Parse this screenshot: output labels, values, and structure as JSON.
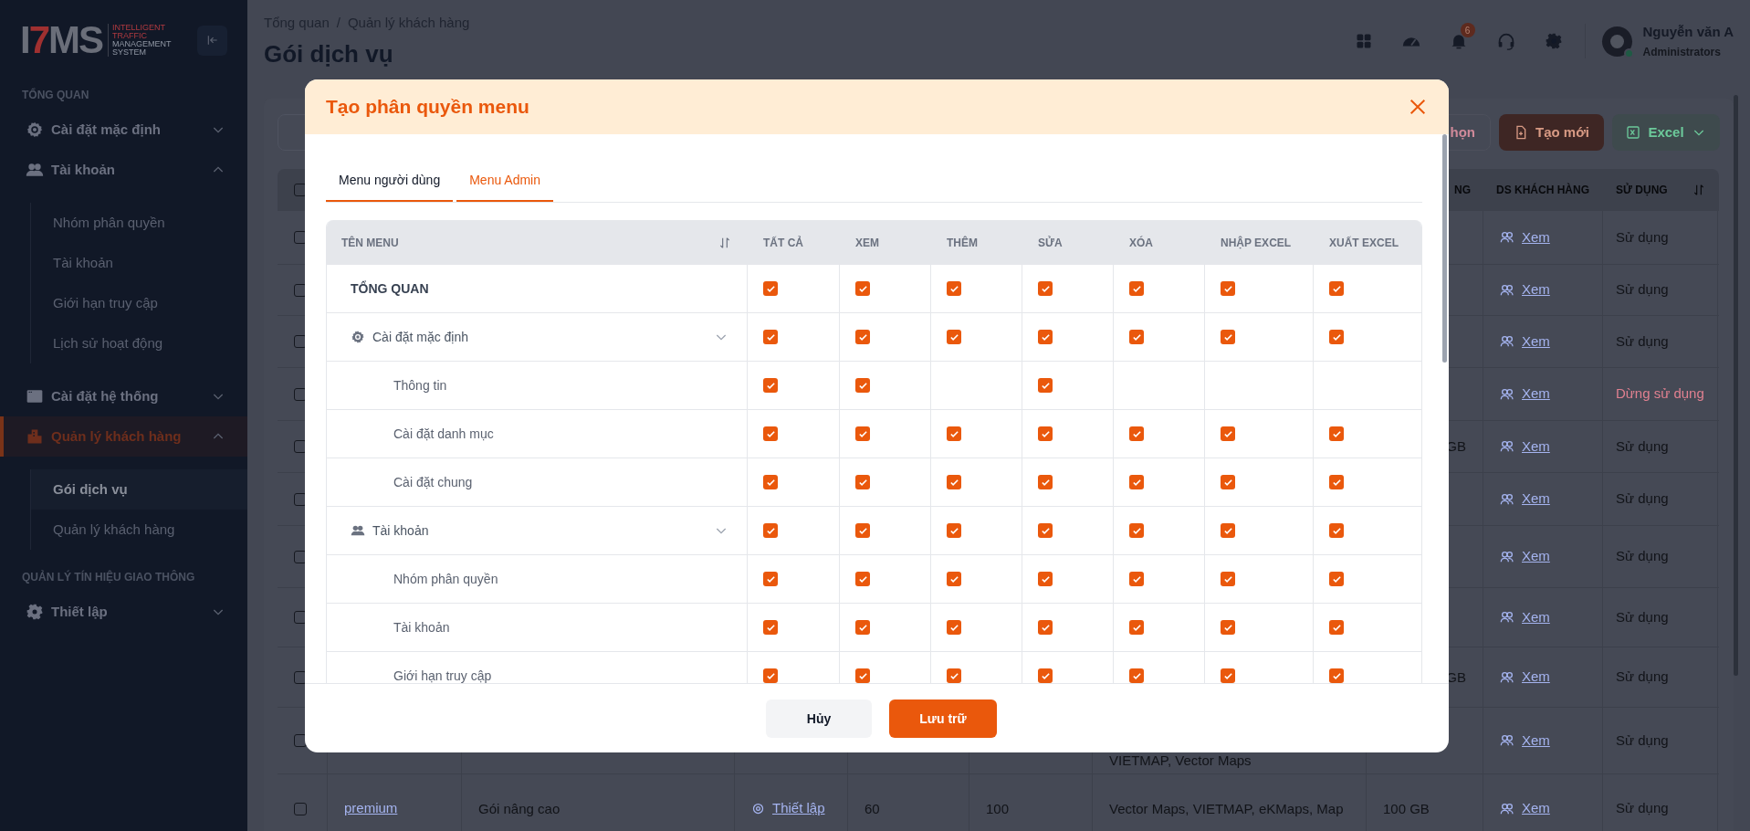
{
  "sidebar": {
    "logo": {
      "mark": "I7MS",
      "tagline": [
        "INTELLIGENT",
        "TRAFFIC",
        "MANAGEMENT",
        "SYSTEM"
      ]
    },
    "sections": [
      {
        "title": "TỔNG QUAN",
        "items": [
          {
            "label": "Cài đặt mặc định",
            "expanded": false,
            "selected": false
          },
          {
            "label": "Tài khoản",
            "expanded": true,
            "selected": false,
            "children": [
              {
                "label": "Nhóm phân quyền",
                "selected": false
              },
              {
                "label": "Tài khoản",
                "selected": false
              },
              {
                "label": "Giới hạn truy cập",
                "selected": false
              },
              {
                "label": "Lịch sử hoạt động",
                "selected": false
              }
            ]
          },
          {
            "label": "Cài đặt hệ thống",
            "expanded": false,
            "selected": false
          },
          {
            "label": "Quản lý khách hàng",
            "expanded": true,
            "selected": true,
            "children": [
              {
                "label": "Gói dịch vụ",
                "selected": true
              },
              {
                "label": "Quản lý khách hàng",
                "selected": false
              }
            ]
          }
        ]
      },
      {
        "title": "QUẢN LÝ TÍN HIỆU GIAO THÔNG",
        "items": [
          {
            "label": "Thiết lập",
            "expanded": false,
            "selected": false
          }
        ]
      }
    ]
  },
  "header": {
    "breadcrumb": [
      "Tổng quan",
      "Quản lý khách hàng"
    ],
    "breadcrumb_separator": "/",
    "title": "Gói dịch vụ",
    "notification_count": "6",
    "user": {
      "name": "Nguyễn văn A",
      "role": "Administrators",
      "online": true
    }
  },
  "toolbar": {
    "filter_button": "họn",
    "create_button": "Tạo mới",
    "excel_button": "Excel"
  },
  "table": {
    "select_all_checked": false,
    "columns": [
      null,
      null,
      null,
      null,
      null,
      null,
      "NG",
      "DS KHÁCH HÀNG",
      "SỬ DỤNG"
    ],
    "rows": [
      {
        "checked": false,
        "cells": [
          null,
          null,
          null,
          null,
          null,
          null,
          null,
          "Xem",
          "Sử dụng"
        ],
        "stopped": false
      },
      {
        "checked": false,
        "cells": [
          null,
          null,
          null,
          null,
          null,
          null,
          null,
          "Xem",
          "Sử dụng"
        ],
        "stopped": false
      },
      {
        "checked": false,
        "cells": [
          null,
          null,
          null,
          null,
          null,
          null,
          null,
          "Xem",
          "Sử dụng"
        ],
        "stopped": false
      },
      {
        "checked": false,
        "cells": [
          null,
          null,
          null,
          null,
          null,
          null,
          null,
          "Xem",
          "Dừng sử dụng"
        ],
        "stopped": true
      },
      {
        "checked": false,
        "cells": [
          null,
          null,
          null,
          null,
          null,
          null,
          "GB",
          "Xem",
          "Sử dụng"
        ],
        "stopped": false
      },
      {
        "checked": false,
        "cells": [
          null,
          null,
          null,
          null,
          null,
          null,
          null,
          "Xem",
          "Sử dụng"
        ],
        "stopped": false
      },
      {
        "checked": false,
        "cells": [
          null,
          null,
          null,
          null,
          null,
          null,
          null,
          "Xem",
          "Sử dụng"
        ],
        "stopped": false
      },
      {
        "checked": false,
        "cells": [
          null,
          null,
          null,
          null,
          null,
          null,
          null,
          "Xem",
          "Sử dụng"
        ],
        "stopped": false
      },
      {
        "checked": false,
        "cells": [
          null,
          null,
          null,
          null,
          null,
          null,
          "GB",
          "Xem",
          "Sử dụng"
        ],
        "stopped": false
      },
      {
        "checked": false,
        "cells": [
          null,
          null,
          null,
          null,
          null,
          "VIETMAP, Vector Maps",
          null,
          "Xem",
          "Sử dụng"
        ],
        "stopped": false
      },
      {
        "checked": false,
        "cells": [
          "premium",
          "Gói nâng cao",
          "Thiết lập",
          "60",
          "100",
          "Vector Maps, VIETMAP, eKMaps, Map",
          "100 GB",
          "Xem",
          "Sử dụng"
        ],
        "stopped": false
      }
    ]
  },
  "modal": {
    "title": "Tạo phân quyền menu",
    "tabs": [
      {
        "label": "Menu người dùng",
        "selected": false
      },
      {
        "label": "Menu Admin",
        "selected": true
      }
    ],
    "table": {
      "columns": [
        "TÊN MENU",
        "TẤT CẢ",
        "XEM",
        "THÊM",
        "SỬA",
        "XÓA",
        "NHẬP EXCEL",
        "XUẤT EXCEL"
      ],
      "rows": [
        {
          "label": "TỔNG QUAN",
          "kind": "section",
          "perms": [
            {
              "kind": "checkbox",
              "checked": true
            },
            {
              "kind": "checkbox",
              "checked": true
            },
            {
              "kind": "checkbox",
              "checked": true
            },
            {
              "kind": "checkbox",
              "checked": true
            },
            {
              "kind": "checkbox",
              "checked": true
            },
            {
              "kind": "checkbox",
              "checked": true
            },
            {
              "kind": "checkbox",
              "checked": true
            }
          ]
        },
        {
          "label": "Cài đặt mặc định",
          "kind": "group",
          "perms": [
            {
              "kind": "checkbox",
              "checked": true
            },
            {
              "kind": "checkbox",
              "checked": true
            },
            {
              "kind": "checkbox",
              "checked": true
            },
            {
              "kind": "checkbox",
              "checked": true
            },
            {
              "kind": "checkbox",
              "checked": true
            },
            {
              "kind": "checkbox",
              "checked": true
            },
            {
              "kind": "checkbox",
              "checked": true
            }
          ],
          "children": [
            {
              "label": "Thông tin",
              "kind": "item",
              "perms": [
                {
                  "kind": "checkbox",
                  "checked": true
                },
                {
                  "kind": "checkbox",
                  "checked": true
                },
                {
                  "kind": "blank"
                },
                {
                  "kind": "checkbox",
                  "checked": true
                },
                {
                  "kind": "blank"
                },
                {
                  "kind": "blank"
                },
                {
                  "kind": "blank"
                }
              ]
            },
            {
              "label": "Cài đặt danh mục",
              "kind": "item",
              "perms": [
                {
                  "kind": "checkbox",
                  "checked": true
                },
                {
                  "kind": "checkbox",
                  "checked": true
                },
                {
                  "kind": "checkbox",
                  "checked": true
                },
                {
                  "kind": "checkbox",
                  "checked": true
                },
                {
                  "kind": "checkbox",
                  "checked": true
                },
                {
                  "kind": "checkbox",
                  "checked": true
                },
                {
                  "kind": "checkbox",
                  "checked": true
                }
              ]
            },
            {
              "label": "Cài đặt chung",
              "kind": "item",
              "perms": [
                {
                  "kind": "checkbox",
                  "checked": true
                },
                {
                  "kind": "checkbox",
                  "checked": true
                },
                {
                  "kind": "checkbox",
                  "checked": true
                },
                {
                  "kind": "checkbox",
                  "checked": true
                },
                {
                  "kind": "checkbox",
                  "checked": true
                },
                {
                  "kind": "checkbox",
                  "checked": true
                },
                {
                  "kind": "checkbox",
                  "checked": true
                }
              ]
            }
          ]
        },
        {
          "label": "Tài khoản",
          "kind": "group",
          "perms": [
            {
              "kind": "checkbox",
              "checked": true
            },
            {
              "kind": "checkbox",
              "checked": true
            },
            {
              "kind": "checkbox",
              "checked": true
            },
            {
              "kind": "checkbox",
              "checked": true
            },
            {
              "kind": "checkbox",
              "checked": true
            },
            {
              "kind": "checkbox",
              "checked": true
            },
            {
              "kind": "checkbox",
              "checked": true
            }
          ],
          "children": [
            {
              "label": "Nhóm phân quyền",
              "kind": "item",
              "perms": [
                {
                  "kind": "checkbox",
                  "checked": true
                },
                {
                  "kind": "checkbox",
                  "checked": true
                },
                {
                  "kind": "checkbox",
                  "checked": true
                },
                {
                  "kind": "checkbox",
                  "checked": true
                },
                {
                  "kind": "checkbox",
                  "checked": true
                },
                {
                  "kind": "checkbox",
                  "checked": true
                },
                {
                  "kind": "checkbox",
                  "checked": true
                }
              ]
            },
            {
              "label": "Tài khoản",
              "kind": "item",
              "perms": [
                {
                  "kind": "checkbox",
                  "checked": true
                },
                {
                  "kind": "checkbox",
                  "checked": true
                },
                {
                  "kind": "checkbox",
                  "checked": true
                },
                {
                  "kind": "checkbox",
                  "checked": true
                },
                {
                  "kind": "checkbox",
                  "checked": true
                },
                {
                  "kind": "checkbox",
                  "checked": true
                },
                {
                  "kind": "checkbox",
                  "checked": true
                }
              ]
            },
            {
              "label": "Giới hạn truy cập",
              "kind": "item",
              "perms": [
                {
                  "kind": "checkbox",
                  "checked": true
                },
                {
                  "kind": "checkbox",
                  "checked": true
                },
                {
                  "kind": "checkbox",
                  "checked": true
                },
                {
                  "kind": "checkbox",
                  "checked": true
                },
                {
                  "kind": "checkbox",
                  "checked": true
                },
                {
                  "kind": "checkbox",
                  "checked": true
                },
                {
                  "kind": "checkbox",
                  "checked": true
                }
              ]
            }
          ]
        }
      ]
    },
    "buttons": [
      {
        "label": "Hủy",
        "kind": "secondary"
      },
      {
        "label": "Lưu trữ",
        "kind": "primary"
      }
    ]
  }
}
